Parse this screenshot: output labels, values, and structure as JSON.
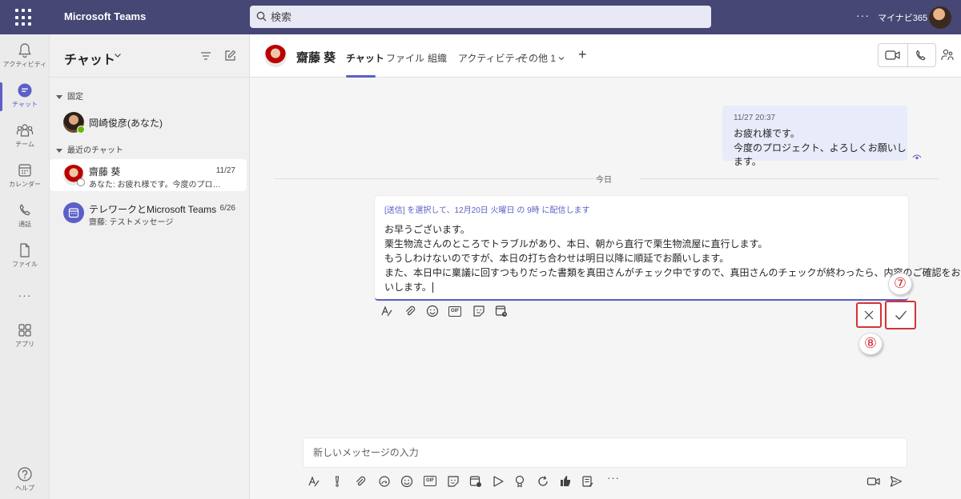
{
  "app": {
    "title": "Microsoft Teams",
    "tenant": "マイナビ365"
  },
  "search": {
    "placeholder": "検索"
  },
  "rail": {
    "items": [
      {
        "label": "アクティビティ",
        "icon": "bell-icon"
      },
      {
        "label": "チャット",
        "icon": "chat-icon",
        "active": true
      },
      {
        "label": "チーム",
        "icon": "teams-icon"
      },
      {
        "label": "カレンダー",
        "icon": "calendar-icon"
      },
      {
        "label": "通話",
        "icon": "phone-icon"
      },
      {
        "label": "ファイル",
        "icon": "file-icon"
      },
      {
        "label": "アプリ",
        "icon": "apps-icon"
      },
      {
        "label": "ヘルプ",
        "icon": "help-icon"
      }
    ]
  },
  "chatlist": {
    "title": "チャット",
    "pinned_label": "固定",
    "recent_label": "最近のチャット",
    "pinned": [
      {
        "name": "岡崎俊彦(あなた)"
      }
    ],
    "recent": [
      {
        "name": "齋藤 葵",
        "preview": "あなた: お疲れ様です。今度のプロジェクト、よろしくお願いします。",
        "date": "11/27"
      },
      {
        "name": "テレワークとMicrosoft Teams",
        "preview": "齋藤: テストメッセージ",
        "date": "6/26"
      }
    ]
  },
  "conversation": {
    "name": "齋藤 葵",
    "tabs": [
      "チャット",
      "ファイル",
      "組織",
      "アクティビティ",
      "その他 1"
    ],
    "sent_message": {
      "time": "11/27 20:37",
      "lines": [
        "お疲れ様です。",
        "今度のプロジェクト、よろしくお願いします。"
      ]
    },
    "day_divider": "今日",
    "edit": {
      "schedule_note": "[送信] を選択して、12月20日 火曜日 の 9時 に配信します",
      "lines": [
        "お早うございます。",
        "栗生物流さんのところでトラブルがあり、本日、朝から直行で栗生物流屋に直行します。",
        "もうしわけないのですが、本日の打ち合わせは明日以降に順延でお願いします。",
        "また、本日中に稟議に回すつもりだった書類を真田さんがチェック中ですので、真田さんのチェックが終わったら、内容のご確認をお願",
        "いします。"
      ]
    },
    "markers": {
      "ok": "⑦",
      "cancel": "⑧"
    },
    "composer_placeholder": "新しいメッセージの入力"
  },
  "colors": {
    "brand": "#464775",
    "accent": "#5b5fc7",
    "highlight": "#d13438",
    "bubble": "#e8ebfa"
  }
}
